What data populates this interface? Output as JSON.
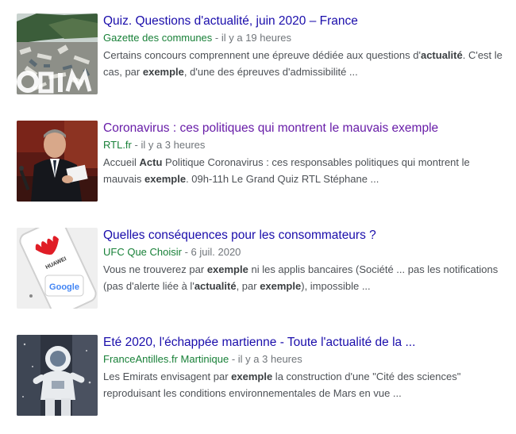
{
  "results": [
    {
      "thumbnail_icon": "polluted-beach-thumbnail",
      "title": "Quiz. Questions d'actualité, juin 2020 – France",
      "source": "Gazette des communes",
      "separator": " - ",
      "time": "il y a 19 heures",
      "snippet": [
        {
          "t": "Certains concours comprennent une épreuve dédiée aux questions d'",
          "b": false
        },
        {
          "t": "actualité",
          "b": true
        },
        {
          "t": ". C'est le cas, par ",
          "b": false
        },
        {
          "t": "exemple",
          "b": true
        },
        {
          "t": ", d'une des épreuves d'admissibilité ...",
          "b": false
        }
      ]
    },
    {
      "thumbnail_icon": "politician-speaking-thumbnail",
      "title": "Coronavirus : ces politiques qui montrent le mauvais exemple",
      "source": "RTL.fr",
      "separator": " - ",
      "time": "il y a 3 heures",
      "snippet": [
        {
          "t": "Accueil ",
          "b": false
        },
        {
          "t": "Actu",
          "b": true
        },
        {
          "t": " Politique Coronavirus : ces responsables politiques qui montrent le mauvais ",
          "b": false
        },
        {
          "t": "exemple",
          "b": true
        },
        {
          "t": ". 09h-11h Le Grand Quiz RTL Stéphane ...",
          "b": false
        }
      ]
    },
    {
      "thumbnail_icon": "huawei-phone-thumbnail",
      "title": "Quelles conséquences pour les consommateurs ?",
      "source": "UFC Que Choisir",
      "separator": " - ",
      "time": "6 juil. 2020",
      "snippet": [
        {
          "t": "Vous ne trouverez par ",
          "b": false
        },
        {
          "t": "exemple",
          "b": true
        },
        {
          "t": " ni les applis bancaires (Société ... pas les notifications (pas d'alerte liée à l'",
          "b": false
        },
        {
          "t": "actualité",
          "b": true
        },
        {
          "t": ", par ",
          "b": false
        },
        {
          "t": "exemple",
          "b": true
        },
        {
          "t": "), impossible ...",
          "b": false
        }
      ]
    },
    {
      "thumbnail_icon": "astronaut-mural-thumbnail",
      "title": "Eté 2020, l'échappée martienne - Toute l'actualité de la ...",
      "source": "FranceAntilles.fr Martinique",
      "separator": " - ",
      "time": "il y a 3 heures",
      "snippet": [
        {
          "t": "Les Emirats envisagent par ",
          "b": false
        },
        {
          "t": "exemple",
          "b": true
        },
        {
          "t": " la construction d'une \"Cité des sciences\" reproduisant les conditions environnementales de Mars en vue ...",
          "b": false
        }
      ]
    }
  ],
  "thumb_text": {
    "huawei_brand": "HUAWEI",
    "google_brand": "Google"
  },
  "colors": {
    "title_link": "#1a0dab",
    "title_visited": "#681da8",
    "source": "#188038",
    "snippet": "#4d5156"
  }
}
